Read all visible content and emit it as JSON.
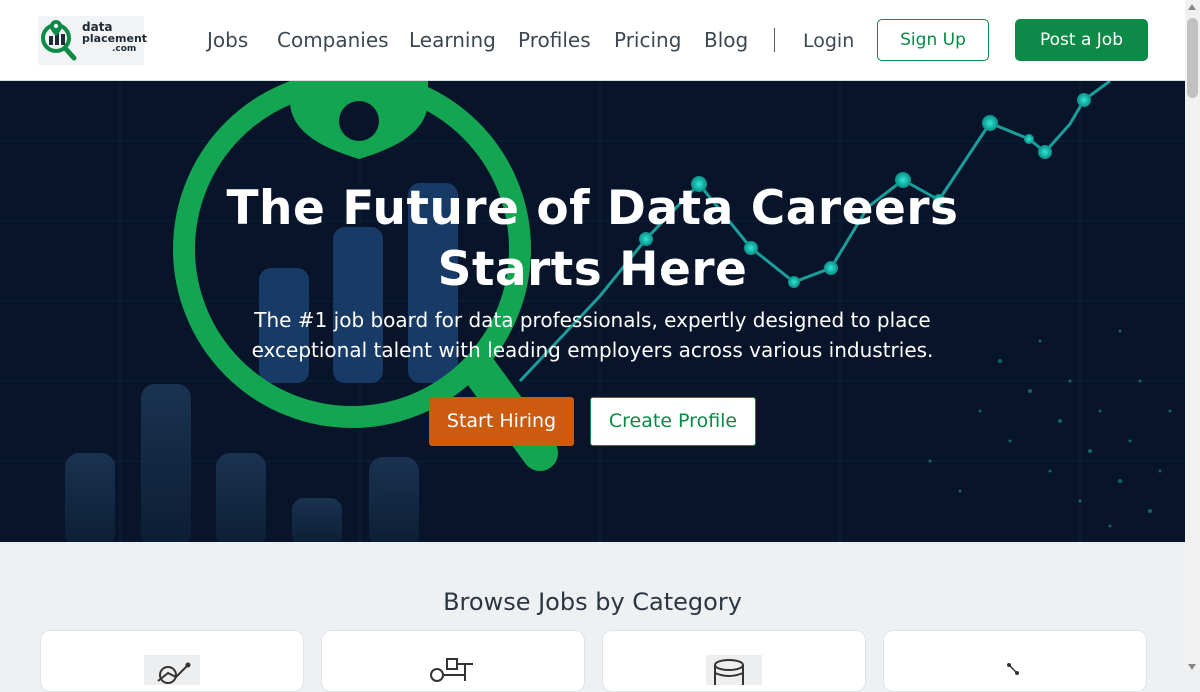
{
  "header": {
    "logo": {
      "line1": "data",
      "line2": "placement",
      "line3": ".com"
    },
    "nav": [
      "Jobs",
      "Companies",
      "Learning",
      "Profiles",
      "Pricing",
      "Blog"
    ],
    "login": "Login",
    "signup": "Sign Up",
    "post_job": "Post a Job"
  },
  "hero": {
    "title_line1": "The Future of Data Careers",
    "title_line2": "Starts Here",
    "subtitle_line1": "The #1 job board for data professionals, expertly designed to place",
    "subtitle_line2": "exceptional talent with leading employers across various industries.",
    "start_hiring": "Start Hiring",
    "create_profile": "Create Profile"
  },
  "categories": {
    "title": "Browse Jobs by Category",
    "cards": [
      {
        "icon": "analytics-chart-icon"
      },
      {
        "icon": "engineering-pipeline-icon"
      },
      {
        "icon": "database-icon"
      },
      {
        "icon": "network-graph-icon"
      }
    ]
  },
  "colors": {
    "brand_green": "#0e8a48",
    "accent_orange": "#cc5a0f",
    "hero_bg": "#07142a",
    "teal_dots": "#1fb5ad"
  }
}
